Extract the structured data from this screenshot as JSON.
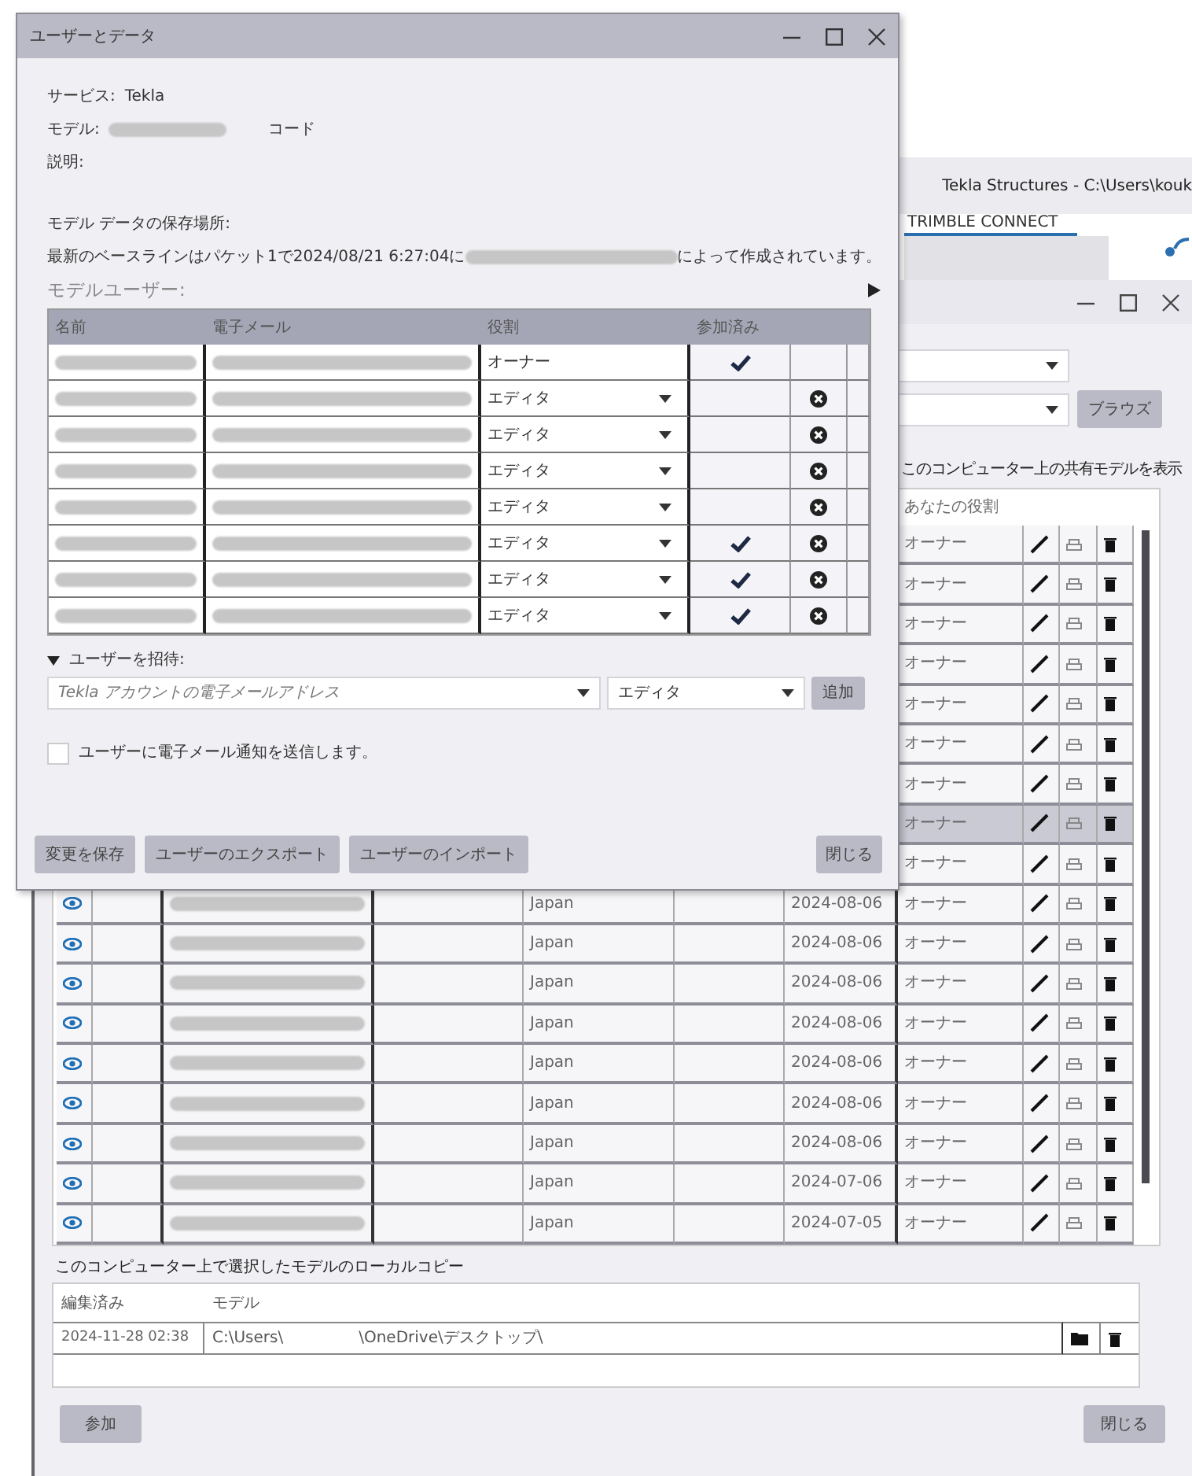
{
  "background_window": {
    "title": "Tekla Structures - C:\\Users\\kouk",
    "tabs": [
      {
        "label": "TRIMBLE CONNECT",
        "selected": true
      }
    ]
  },
  "shared_models_window": {
    "browse_button": "ブラウズ",
    "list_label": "このコンピューター上の共有モデルを表示",
    "role_column": "あなたの役割",
    "rows": [
      {
        "role": "オーナー",
        "selected": false
      },
      {
        "role": "オーナー",
        "selected": false
      },
      {
        "role": "オーナー",
        "selected": false
      },
      {
        "role": "オーナー",
        "selected": false
      },
      {
        "role": "オーナー",
        "selected": false
      },
      {
        "role": "オーナー",
        "selected": false
      },
      {
        "role": "オーナー",
        "selected": false
      },
      {
        "role": "オーナー",
        "selected": true
      },
      {
        "role": "オーナー",
        "selected": false
      },
      {
        "country": "Japan",
        "date": "2024-08-06",
        "role": "オーナー",
        "selected": false
      },
      {
        "country": "Japan",
        "date": "2024-08-06",
        "role": "オーナー",
        "selected": false
      },
      {
        "country": "Japan",
        "date": "2024-08-06",
        "role": "オーナー",
        "selected": false
      },
      {
        "country": "Japan",
        "date": "2024-08-06",
        "role": "オーナー",
        "selected": false
      },
      {
        "country": "Japan",
        "date": "2024-08-06",
        "role": "オーナー",
        "selected": false
      },
      {
        "country": "Japan",
        "date": "2024-08-06",
        "role": "オーナー",
        "selected": false
      },
      {
        "country": "Japan",
        "date": "2024-08-06",
        "role": "オーナー",
        "selected": false
      },
      {
        "country": "Japan",
        "date": "2024-07-06",
        "role": "オーナー",
        "selected": false
      },
      {
        "country": "Japan",
        "date": "2024-07-05",
        "role": "オーナー",
        "selected": false
      }
    ],
    "local_copy": {
      "title": "このコンピューター上で選択したモデルのローカルコピー",
      "columns": [
        "編集済み",
        "モデル"
      ],
      "rows": [
        {
          "edited": "2024-11-28 02:38",
          "path_start": "C:\\Users\\",
          "path_end": "\\OneDrive\\デスクトップ\\"
        }
      ]
    },
    "join_button": "参加",
    "close_button": "閉じる"
  },
  "dialog": {
    "title": "ユーザーとデータ",
    "service_label": "サービス:",
    "service": "Tekla",
    "model_label": "モデル:",
    "code_label": "コード",
    "description_label": "説明:",
    "storage_label": "モデル データの保存場所:",
    "baseline_before": "最新のベースラインはパケット1で2024/08/21 6:27:04に",
    "baseline_after": "によって作成されています。",
    "users_label": "モデルユーザー:",
    "users_columns": [
      "名前",
      "電子メール",
      "役割",
      "参加済み"
    ],
    "users": [
      {
        "kind": "fixed",
        "role": "オーナー",
        "joined": true,
        "removable": false
      },
      {
        "kind": "dropdown",
        "role": "エディタ",
        "joined": false,
        "removable": true
      },
      {
        "kind": "dropdown",
        "role": "エディタ",
        "joined": false,
        "removable": true
      },
      {
        "kind": "dropdown",
        "role": "エディタ",
        "joined": false,
        "removable": true
      },
      {
        "kind": "dropdown",
        "role": "エディタ",
        "joined": false,
        "removable": true
      },
      {
        "kind": "dropdown",
        "role": "エディタ",
        "joined": true,
        "removable": true
      },
      {
        "kind": "dropdown",
        "role": "エディタ",
        "joined": true,
        "removable": true
      },
      {
        "kind": "dropdown",
        "role": "エディタ",
        "joined": true,
        "removable": true
      }
    ],
    "invite_label": "ユーザーを招待:",
    "invite_expanded": true,
    "invite_email_placeholder": "Tekla アカウントの電子メールアドレス",
    "invite_role": "エディタ",
    "add_button": "追加",
    "notify": {
      "label": "ユーザーに電子メール通知を送信します。",
      "checked": false
    },
    "buttons": [
      "変更を保存",
      "ユーザーのエクスポート",
      "ユーザーのインポート"
    ],
    "close_button": "閉じる"
  }
}
